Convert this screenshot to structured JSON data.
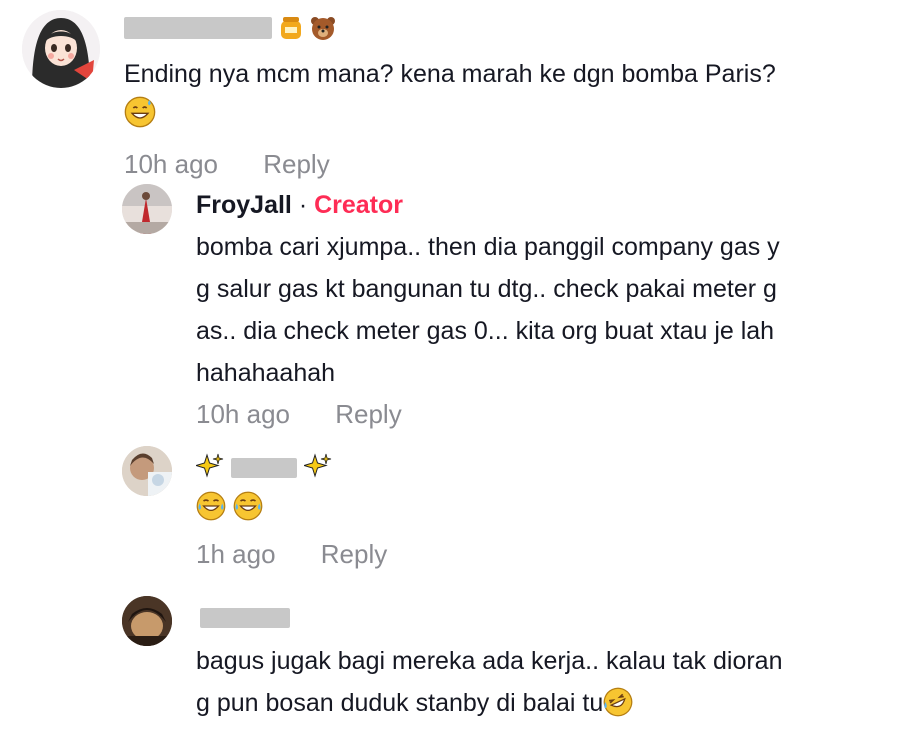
{
  "comments": [
    {
      "username": "",
      "username_emojis": [
        "honey-pot-emoji",
        "bear-emoji"
      ],
      "text": "Ending nya mcm mana? kena marah ke dgn bomba Paris?",
      "text_emoji": "grinning-sweat-emoji",
      "time": "10h ago",
      "reply_label": "Reply"
    },
    {
      "username": "FroyJall",
      "separator": " · ",
      "badge": "Creator",
      "text_lines": [
        "bomba cari xjumpa.. then dia panggil company gas y",
        "g salur gas kt bangunan tu dtg.. check pakai meter g",
        "as.. dia check meter gas 0... kita org buat xtau je lah",
        "hahahaahah"
      ],
      "time": "10h ago",
      "reply_label": "Reply"
    },
    {
      "username": "",
      "username_emojis": [
        "sparkles-emoji",
        "sparkles-emoji"
      ],
      "text_emojis": [
        "tears-of-joy-emoji",
        "tears-of-joy-emoji"
      ],
      "time": "1h ago",
      "reply_label": "Reply"
    },
    {
      "username": "",
      "text_lines": [
        "bagus jugak bagi mereka ada kerja.. kalau tak dioran",
        "g pun bosan duduk stanby di balai tu"
      ],
      "text_emoji": "rolling-laughing-emoji"
    }
  ],
  "colors": {
    "text": "#161823",
    "meta": "#8a8b91",
    "creator": "#fe2c55",
    "redaction": "#c8c8c8"
  }
}
